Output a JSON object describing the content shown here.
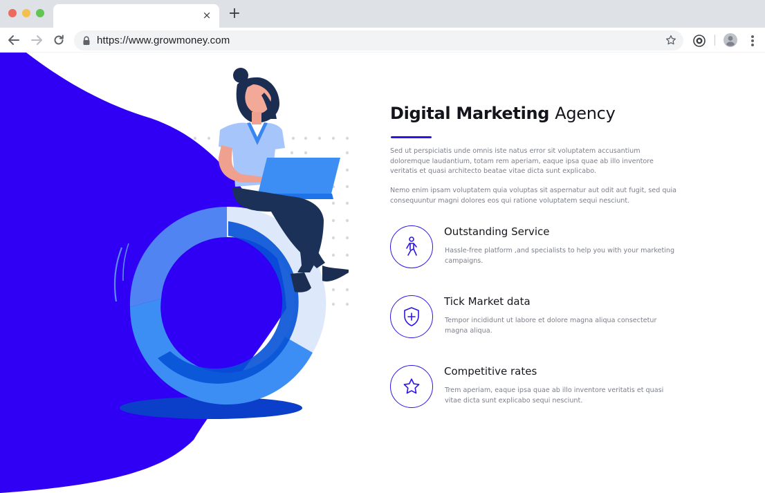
{
  "browser": {
    "url": "https://www.growmoney.com",
    "tab_close_glyph": "×",
    "new_tab_glyph": "+",
    "icons": {
      "back": "back-arrow-icon",
      "forward": "forward-arrow-icon",
      "reload": "reload-icon",
      "lock": "lock-icon",
      "bookmark": "star-icon",
      "extension": "extension-icon",
      "profile": "profile-icon",
      "menu": "kebab-menu-icon"
    }
  },
  "hero": {
    "title_bold": "Digital Marketing",
    "title_light": "Agency",
    "paragraphs": [
      "Sed ut perspiciatis unde omnis iste natus error sit voluptatem accusantium doloremque laudantium, totam rem aperiam, eaque ipsa quae ab illo inventore veritatis et quasi architecto beatae vitae dicta sunt explicabo.",
      "Nemo enim ipsam voluptatem quia voluptas sit aspernatur aut odit aut fugit, sed quia consequuntur magni dolores eos qui ratione voluptatem sequi nesciunt."
    ]
  },
  "features": [
    {
      "icon": "walking-person-icon",
      "title": "Outstanding Service",
      "description": "Hassle-free platform ,and specialists to help you with your marketing campaigns."
    },
    {
      "icon": "shield-plus-icon",
      "title": "Tick Market data",
      "description": "Tempor incididunt ut labore et dolore magna aliqua consectetur magna aliqua."
    },
    {
      "icon": "star-outline-icon",
      "title": "Competitive rates",
      "description": "Trem aperiam, eaque ipsa quae ab illo inventore veritatis et quasi  vitae dicta sunt explicabo sequi nesciunt."
    }
  ],
  "colors": {
    "accent": "#2b14e8",
    "blob": "#3000f5",
    "ring_light": "#dde9fb",
    "ring_mid": "#3c8ef5",
    "ring_dark": "#0652d6",
    "tab_strip": "#dee1e6",
    "omnibox": "#f1f3f4"
  }
}
